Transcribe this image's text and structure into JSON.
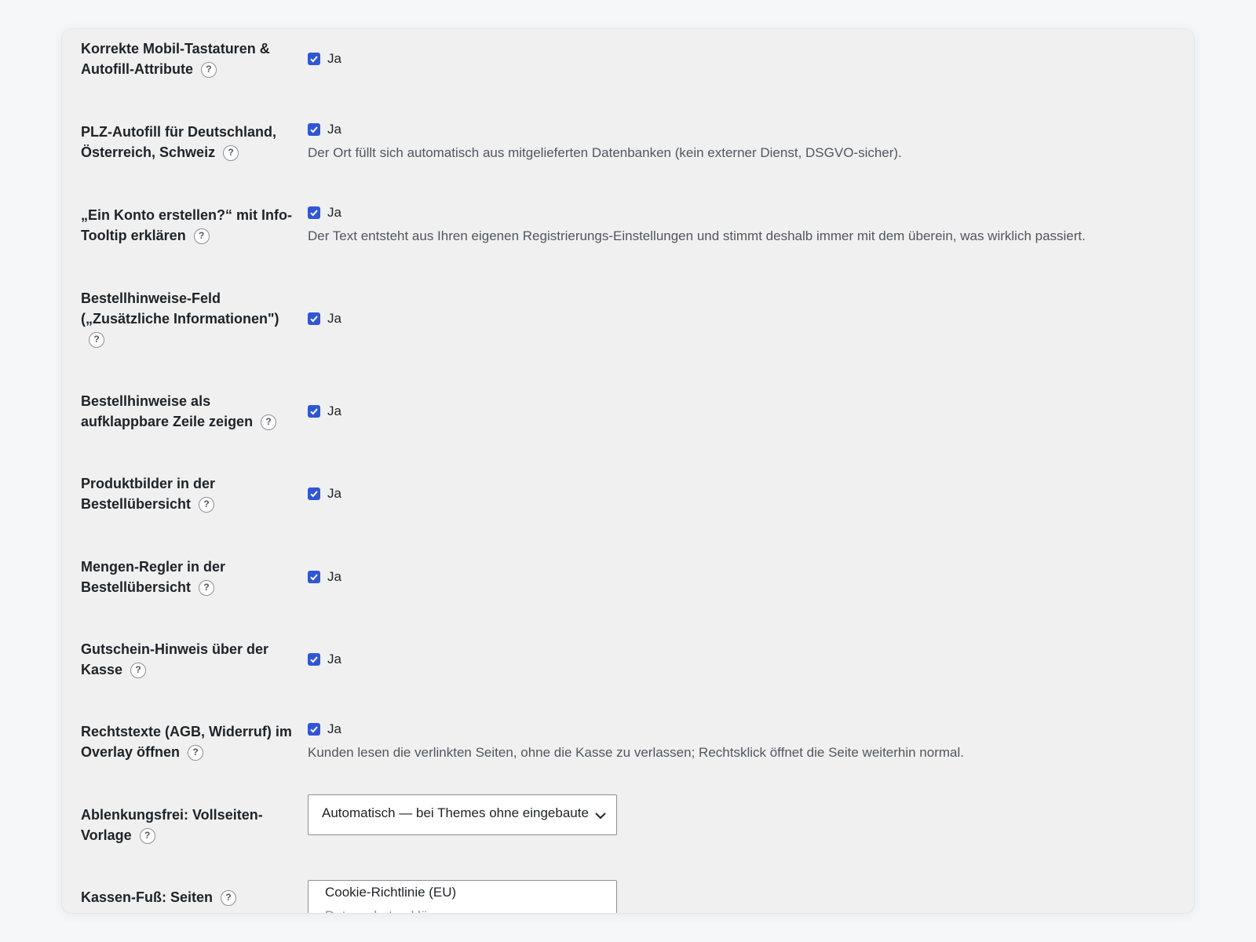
{
  "settings": [
    {
      "label": "Korrekte Mobil-Tastaturen & Autofill-Attribute",
      "control": "checkbox",
      "checked": true,
      "check_label": "Ja",
      "description": ""
    },
    {
      "label": "PLZ-Autofill für Deutschland, Österreich, Schweiz",
      "control": "checkbox",
      "checked": true,
      "check_label": "Ja",
      "description": "Der Ort füllt sich automatisch aus mitgelieferten Datenbanken (kein externer Dienst, DSGVO-sicher)."
    },
    {
      "label": "„Ein Konto erstellen?“ mit Info-Tooltip erklären",
      "control": "checkbox",
      "checked": true,
      "check_label": "Ja",
      "description": "Der Text entsteht aus Ihren eigenen Registrierungs-Einstellungen und stimmt deshalb immer mit dem überein, was wirklich passiert."
    },
    {
      "label": "Bestellhinweise-Feld („Zusätzliche Informationen\")",
      "control": "checkbox",
      "checked": true,
      "check_label": "Ja",
      "description": ""
    },
    {
      "label": "Bestellhinweise als aufklappbare Zeile zeigen",
      "control": "checkbox",
      "checked": true,
      "check_label": "Ja",
      "description": ""
    },
    {
      "label": "Produktbilder in der Bestellübersicht",
      "control": "checkbox",
      "checked": true,
      "check_label": "Ja",
      "description": ""
    },
    {
      "label": "Mengen-Regler in der Bestellübersicht",
      "control": "checkbox",
      "checked": true,
      "check_label": "Ja",
      "description": ""
    },
    {
      "label": "Gutschein-Hinweis über der Kasse",
      "control": "checkbox",
      "checked": true,
      "check_label": "Ja",
      "description": ""
    },
    {
      "label": "Rechtstexte (AGB, Widerruf) im Overlay öffnen",
      "control": "checkbox",
      "checked": true,
      "check_label": "Ja",
      "description": "Kunden lesen die verlinkten Seiten, ohne die Kasse zu verlassen; Rechtsklick öffnet die Seite weiterhin normal."
    },
    {
      "label": "Ablenkungsfrei: Vollseiten-Vorlage",
      "control": "select",
      "selected": "Automatisch — bei Themes ohne eingebaute"
    },
    {
      "label": "Kassen-Fuß: Seiten",
      "control": "multiselect",
      "options": [
        "Cookie-Richtlinie (EU)",
        "Datenschutzerklärung"
      ]
    }
  ],
  "help_icon_glyph": "?",
  "colors": {
    "checkbox": "#2f56d6",
    "card_bg": "#f0f0f1",
    "page_bg": "#f6f7f8",
    "description_text": "#50575e"
  }
}
